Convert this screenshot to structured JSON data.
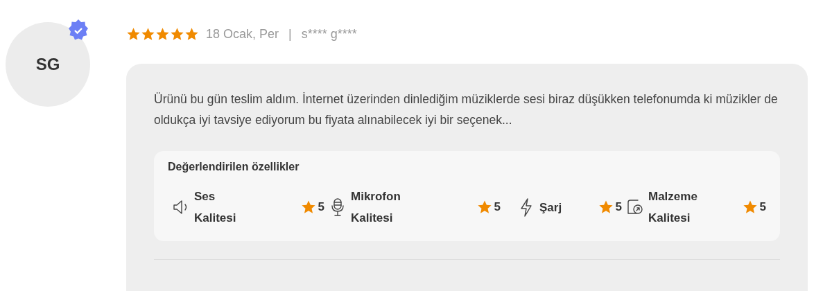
{
  "review": {
    "avatar": {
      "initials": "SG",
      "verified": true
    },
    "stars": 5,
    "date": "18 Ocak, Per",
    "separator": "|",
    "author": "s**** g****",
    "text": "Ürünü bu gün teslim aldım. İnternet üzerinden dinlediğim müziklerde sesi biraz düşükken telefonumda ki müzikler de oldukça iyi tavsiye ediyorum bu fiyata alınabilecek iyi bir seçenek...",
    "features": {
      "title": "Değerlendirilen özellikler",
      "items": [
        {
          "kind": "sound",
          "label": "Ses Kalitesi",
          "score": "5"
        },
        {
          "kind": "mic",
          "label": "Mikrofon Kalitesi",
          "score": "5"
        },
        {
          "kind": "charge",
          "label": "Şarj",
          "score": "5"
        },
        {
          "kind": "material",
          "label": "Malzeme Kalitesi",
          "score": "5"
        }
      ]
    }
  }
}
